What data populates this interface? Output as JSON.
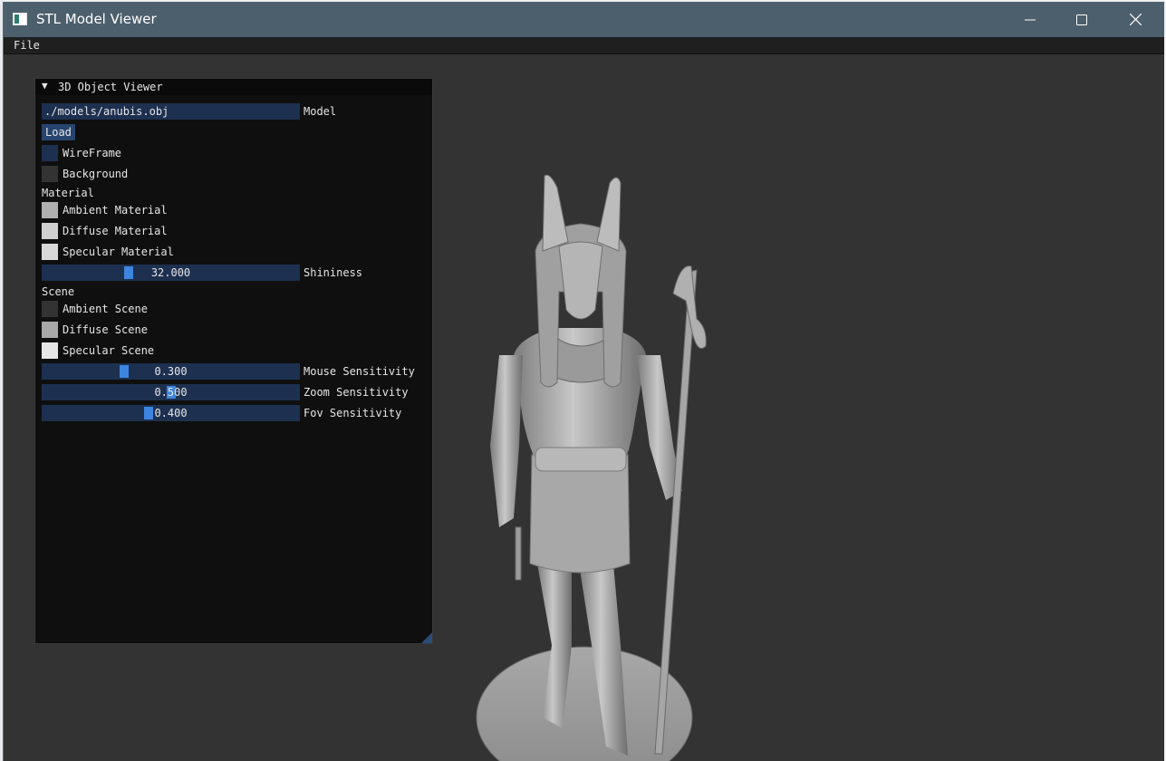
{
  "window": {
    "title": "STL Model Viewer",
    "controls": {
      "minimize": "minimize-icon",
      "maximize": "maximize-icon",
      "close": "close-icon"
    }
  },
  "menubar": {
    "file": "File"
  },
  "panel": {
    "title": "3D Object Viewer",
    "model": {
      "value": "./models/anubis.obj",
      "label": "Model"
    },
    "load_button": "Load",
    "wireframe": {
      "label": "WireFrame",
      "color": "#1d3050"
    },
    "background": {
      "label": "Background",
      "color": "#333333"
    },
    "material_header": "Material",
    "ambient_material": {
      "label": "Ambient Material",
      "color": "#b0b0b0"
    },
    "diffuse_material": {
      "label": "Diffuse Material",
      "color": "#d0d0d0"
    },
    "specular_material": {
      "label": "Specular Material",
      "color": "#d8d8d8"
    },
    "shininess": {
      "value": "32.000",
      "label": "Shininess",
      "fraction": 0.33
    },
    "scene_header": "Scene",
    "ambient_scene": {
      "label": "Ambient Scene",
      "color": "#333333"
    },
    "diffuse_scene": {
      "label": "Diffuse Scene",
      "color": "#a8a8a8"
    },
    "specular_scene": {
      "label": "Specular Scene",
      "color": "#e6e6e6"
    },
    "mouse_sensitivity": {
      "value": "0.300",
      "label": "Mouse Sensitivity",
      "fraction": 0.31
    },
    "zoom_sensitivity": {
      "value": "0.500",
      "label": "Zoom Sensitivity",
      "fraction": 0.5
    },
    "fov_sensitivity": {
      "value": "0.400",
      "label": "Fov Sensitivity",
      "fraction": 0.41
    }
  }
}
